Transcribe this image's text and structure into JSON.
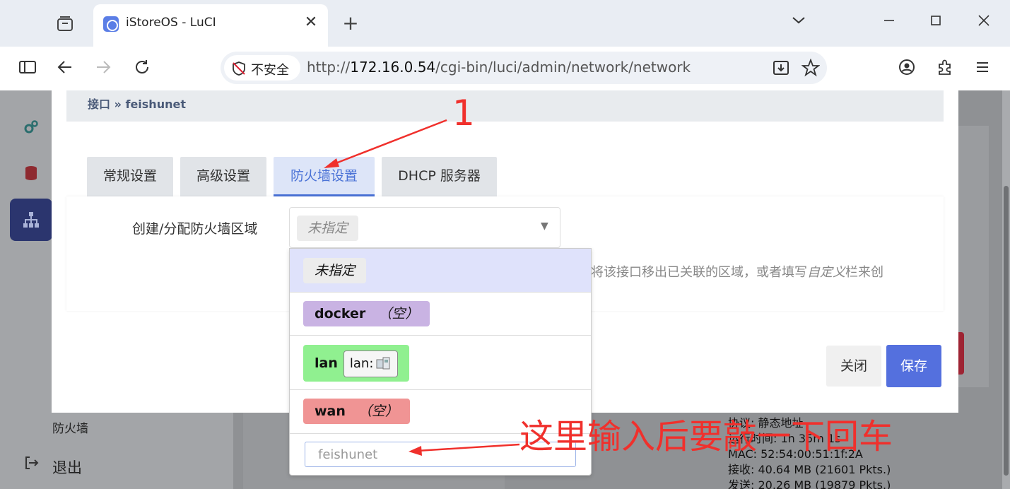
{
  "browser": {
    "tab_title": "iStoreOS - LuCI",
    "tab_close": "✕",
    "new_tab": "+",
    "security_label": "不安全",
    "url_scheme": "http://",
    "url_host": "172.16.0.54",
    "url_path": "/cgi-bin/luci/admin/network/network"
  },
  "background": {
    "sidebar_firewall": "防火墙",
    "sidebar_logout": "退出",
    "info_lines": [
      "协议: 静态地址",
      "运行时间: 1h 35m 1s",
      "MAC: 52:54:00:51:1f:2A",
      "接收: 40.64 MB (21601 Pkts.)",
      "发送: 20.26 MB (19879 Pkts.)"
    ]
  },
  "modal": {
    "breadcrumb": "接口 » feishunet",
    "tabs": [
      {
        "label": "常规设置"
      },
      {
        "label": "高级设置"
      },
      {
        "label": "防火墙设置"
      },
      {
        "label": "DHCP 服务器"
      }
    ],
    "field_label": "创建/分配防火墙区域",
    "select_value": "未指定",
    "description_prefix": "将该接口移出已关联的区域，或者填写",
    "description_em": "自定义",
    "description_suffix": "栏来创",
    "close_label": "关闭",
    "save_label": "保存"
  },
  "dropdown": {
    "options": [
      {
        "label": "未指定",
        "color": "#ececec"
      },
      {
        "label": "docker",
        "note": "（空）",
        "color": "#c9b3e3"
      },
      {
        "label": "lan",
        "network": "lan:",
        "color": "#90f090"
      },
      {
        "label": "wan",
        "note": "（空）",
        "color": "#f09494"
      }
    ],
    "custom_value": "feishunet"
  },
  "annotations": {
    "marker_1": "1",
    "hint": "这里输入后要敲一下回车"
  },
  "colors": {
    "accent": "#5470de",
    "annotation": "#f0302c"
  }
}
